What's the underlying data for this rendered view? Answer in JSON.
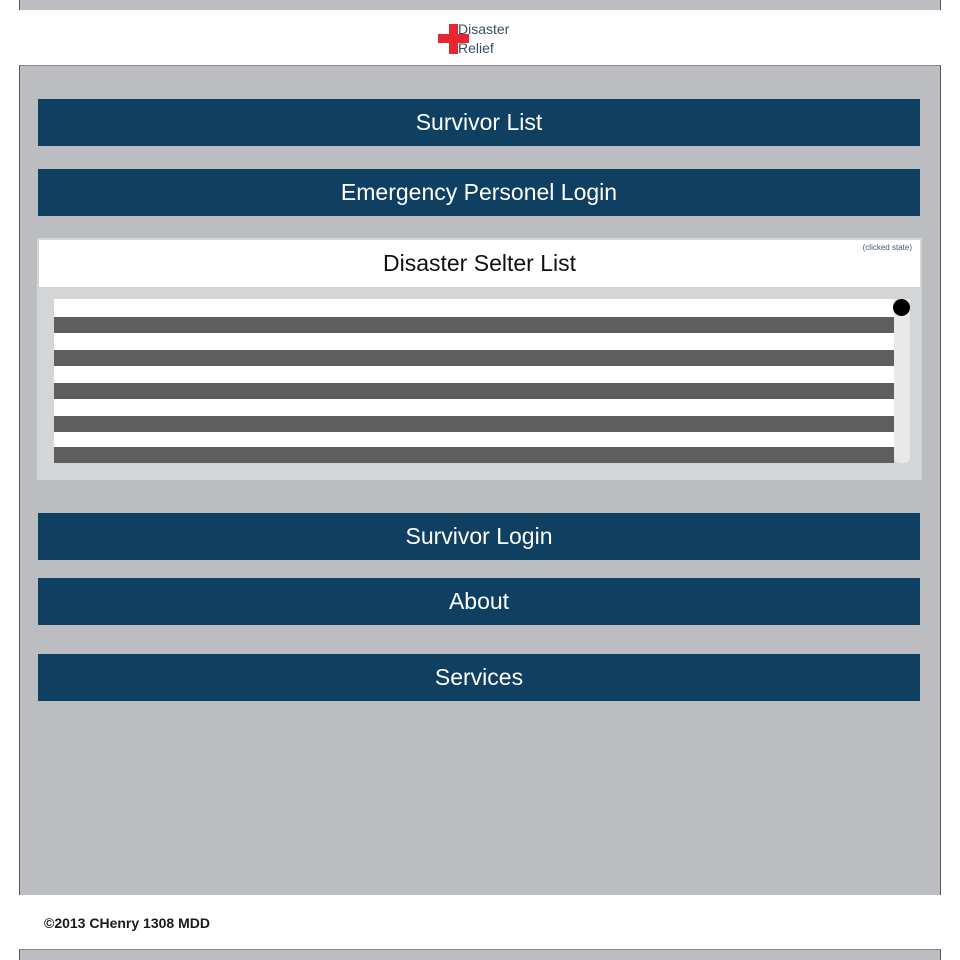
{
  "logo": {
    "line1": "Disaster",
    "line2": "Relief",
    "cross_color": "#e8262d"
  },
  "nav": {
    "survivor_list": "Survivor List",
    "emergency_login": "Emergency Personel Login",
    "survivor_login": "Survivor Login",
    "about": "About",
    "services": "Services"
  },
  "shelter_panel": {
    "title": "Disaster Selter List",
    "state_note": "(clicked state)",
    "row_count": 5
  },
  "footer": {
    "copyright": "©2013 CHenry 1308 MDD"
  },
  "colors": {
    "button_bg": "#0f3f61",
    "button_text": "#ffffff",
    "page_bg": "#bcbdc0",
    "list_row": "#5e5e5e"
  }
}
